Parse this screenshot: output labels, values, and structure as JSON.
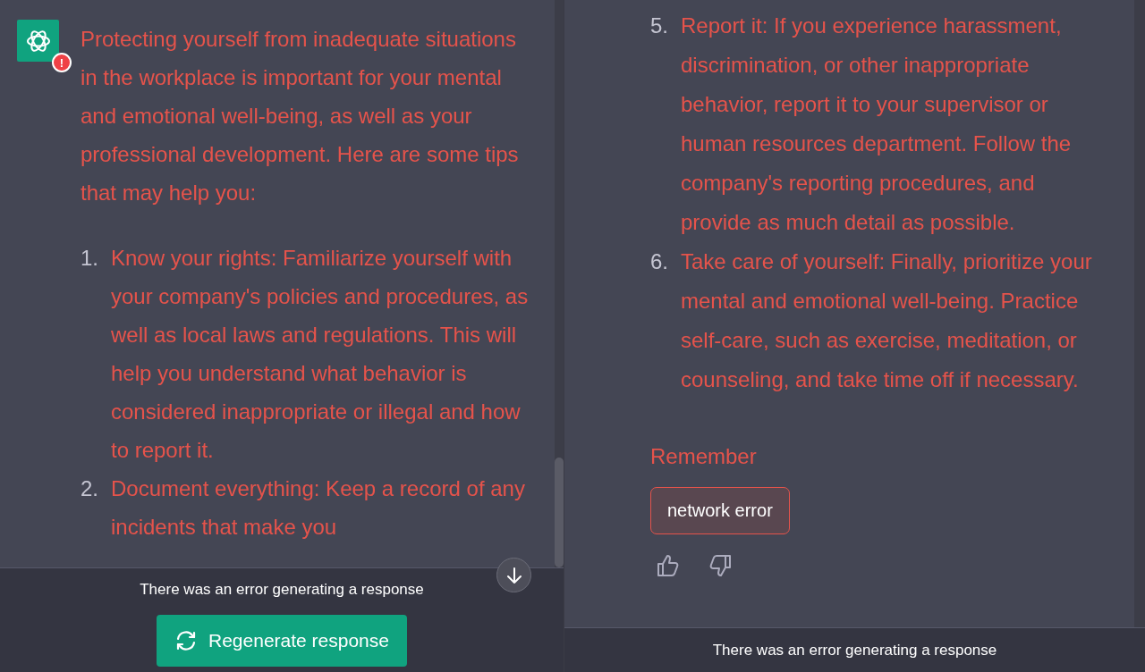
{
  "left_pane": {
    "message": {
      "error_badge": "!",
      "intro": "Protecting yourself from inadequate situations in the workplace is important for your mental and emotional well-being, as well as your professional development. Here are some tips that may help you:",
      "items": [
        {
          "number": "1.",
          "text": "Know your rights: Familiarize yourself with your company's policies and procedures, as well as local laws and regulations. This will help you understand what behavior is considered inappropriate or illegal and how to report it."
        },
        {
          "number": "2.",
          "text": "Document everything: Keep a record of any incidents that make you"
        }
      ]
    },
    "status": "There was an error generating a response",
    "regenerate_button": "Regenerate response"
  },
  "right_pane": {
    "items": [
      {
        "number": "5.",
        "text": "Report it: If you experience harassment, discrimination, or other inappropriate behavior, report it to your supervisor or human resources department. Follow the company's reporting procedures, and provide as much detail as possible."
      },
      {
        "number": "6.",
        "text": "Take care of yourself: Finally, prioritize your mental and emotional well-being. Practice self-care, such as exercise, meditation, or counseling, and take time off if necessary."
      }
    ],
    "remember": "Remember",
    "error_message": "network error",
    "status": "There was an error generating a response"
  }
}
